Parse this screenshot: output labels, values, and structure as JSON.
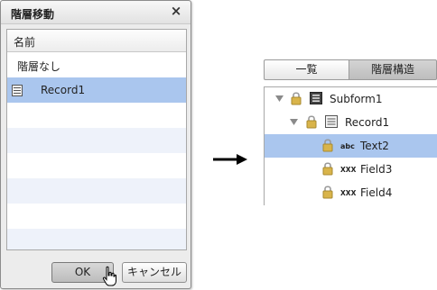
{
  "dialog": {
    "title": "階層移動",
    "close_glyph": "×",
    "column_header": "名前",
    "rows": [
      {
        "label": "階層なし",
        "selected": false
      },
      {
        "label": "Record1",
        "selected": true,
        "icon": "record-icon"
      }
    ],
    "ok_label": "OK",
    "cancel_label": "キャンセル"
  },
  "panel": {
    "tabs": [
      {
        "label": "一覧",
        "active": false
      },
      {
        "label": "階層構造",
        "active": true
      }
    ],
    "tree": [
      {
        "label": "Subform1",
        "icon": "subform-icon",
        "depth": 0,
        "expanded": true,
        "selected": false
      },
      {
        "label": "Record1",
        "icon": "record-icon",
        "depth": 1,
        "expanded": true,
        "selected": false
      },
      {
        "label": "Text2",
        "icon": "text-field-icon",
        "icon_text": "abc",
        "depth": 2,
        "selected": true
      },
      {
        "label": "Field3",
        "icon": "generic-field-icon",
        "icon_text": "XXX",
        "depth": 2,
        "selected": false
      },
      {
        "label": "Field4",
        "icon": "generic-field-icon",
        "icon_text": "XXX",
        "depth": 2,
        "selected": false
      }
    ]
  },
  "colors": {
    "selection": "#aac6ee",
    "alt_row": "#eef2fa",
    "lock_gold": "#d9b44a"
  }
}
